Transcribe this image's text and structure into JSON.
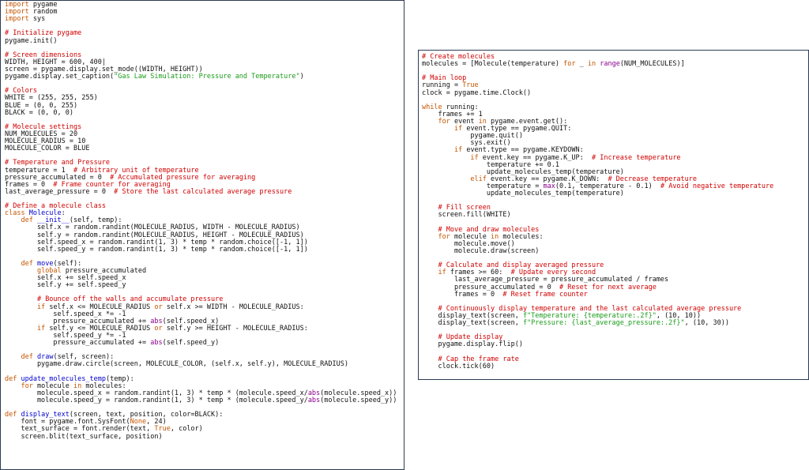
{
  "theme": {
    "keyword": "#c45500",
    "comment": "#d00000",
    "string": "#1a9b1a",
    "builtin": "#8b008b",
    "function": "#0000cc",
    "text": "#111111",
    "border": "#2d3b55"
  },
  "left_code": [
    [
      [
        "kw",
        "import"
      ],
      [
        "ln",
        " pygame"
      ]
    ],
    [
      [
        "kw",
        "import"
      ],
      [
        "ln",
        " random"
      ]
    ],
    [
      [
        "kw",
        "import"
      ],
      [
        "ln",
        " sys"
      ]
    ],
    [],
    [
      [
        "cm",
        "# Initialize pygame"
      ]
    ],
    [
      [
        "ln",
        "pygame.init()"
      ]
    ],
    [],
    [
      [
        "cm",
        "# Screen dimensions"
      ]
    ],
    [
      [
        "ln",
        "WIDTH, HEIGHT = 600, 400|"
      ]
    ],
    [
      [
        "ln",
        "screen = pygame.display.set_mode((WIDTH, HEIGHT))"
      ]
    ],
    [
      [
        "ln",
        "pygame.display.set_caption("
      ],
      [
        "st",
        "\"Gas Law Simulation: Pressure and Temperature\""
      ],
      [
        "ln",
        ")"
      ]
    ],
    [],
    [
      [
        "cm",
        "# Colors"
      ]
    ],
    [
      [
        "ln",
        "WHITE = (255, 255, 255)"
      ]
    ],
    [
      [
        "ln",
        "BLUE = (0, 0, 255)"
      ]
    ],
    [
      [
        "ln",
        "BLACK = (0, 0, 0)"
      ]
    ],
    [],
    [
      [
        "cm",
        "# Molecule settings"
      ]
    ],
    [
      [
        "ln",
        "NUM_MOLECULES = 20"
      ]
    ],
    [
      [
        "ln",
        "MOLECULE_RADIUS = 10"
      ]
    ],
    [
      [
        "ln",
        "MOLECULE_COLOR = BLUE"
      ]
    ],
    [],
    [
      [
        "cm",
        "# Temperature and Pressure"
      ]
    ],
    [
      [
        "ln",
        "temperature = 1  "
      ],
      [
        "cm",
        "# Arbitrary unit of temperature"
      ]
    ],
    [
      [
        "ln",
        "pressure_accumulated = 0  "
      ],
      [
        "cm",
        "# Accumulated pressure for averaging"
      ]
    ],
    [
      [
        "ln",
        "frames = 0  "
      ],
      [
        "cm",
        "# Frame counter for averaging"
      ]
    ],
    [
      [
        "ln",
        "last_average_pressure = 0  "
      ],
      [
        "cm",
        "# Store the last calculated average pressure"
      ]
    ],
    [],
    [
      [
        "cm",
        "# Define a molecule class"
      ]
    ],
    [
      [
        "kw",
        "class"
      ],
      [
        "ln",
        " "
      ],
      [
        "fn",
        "Molecule"
      ],
      [
        "ln",
        ":"
      ]
    ],
    [
      [
        "ln",
        "    "
      ],
      [
        "kw",
        "def"
      ],
      [
        "ln",
        " "
      ],
      [
        "fn",
        "__init__"
      ],
      [
        "ln",
        "(self, temp):"
      ]
    ],
    [
      [
        "ln",
        "        self.x = random.randint(MOLECULE_RADIUS, WIDTH - MOLECULE_RADIUS)"
      ]
    ],
    [
      [
        "ln",
        "        self.y = random.randint(MOLECULE_RADIUS, HEIGHT - MOLECULE_RADIUS)"
      ]
    ],
    [
      [
        "ln",
        "        self.speed_x = random.randint(1, 3) * temp * random.choice([-1, 1])"
      ]
    ],
    [
      [
        "ln",
        "        self.speed_y = random.randint(1, 3) * temp * random.choice([-1, 1])"
      ]
    ],
    [],
    [
      [
        "ln",
        "    "
      ],
      [
        "kw",
        "def"
      ],
      [
        "ln",
        " "
      ],
      [
        "fn",
        "move"
      ],
      [
        "ln",
        "(self):"
      ]
    ],
    [
      [
        "ln",
        "        "
      ],
      [
        "kw",
        "global"
      ],
      [
        "ln",
        " pressure_accumulated"
      ]
    ],
    [
      [
        "ln",
        "        self.x += self.speed_x"
      ]
    ],
    [
      [
        "ln",
        "        self.y += self.speed_y"
      ]
    ],
    [],
    [
      [
        "ln",
        "        "
      ],
      [
        "cm",
        "# Bounce off the walls and accumulate pressure"
      ]
    ],
    [
      [
        "ln",
        "        "
      ],
      [
        "kw",
        "if"
      ],
      [
        "ln",
        " self.x <= MOLECULE_RADIUS "
      ],
      [
        "kw",
        "or"
      ],
      [
        "ln",
        " self.x >= WIDTH - MOLECULE_RADIUS:"
      ]
    ],
    [
      [
        "ln",
        "            self.speed_x *= -1"
      ]
    ],
    [
      [
        "ln",
        "            pressure_accumulated += "
      ],
      [
        "bi",
        "abs"
      ],
      [
        "ln",
        "(self.speed_x)"
      ]
    ],
    [
      [
        "ln",
        "        "
      ],
      [
        "kw",
        "if"
      ],
      [
        "ln",
        " self.y <= MOLECULE_RADIUS "
      ],
      [
        "kw",
        "or"
      ],
      [
        "ln",
        " self.y >= HEIGHT - MOLECULE_RADIUS:"
      ]
    ],
    [
      [
        "ln",
        "            self.speed_y *= -1"
      ]
    ],
    [
      [
        "ln",
        "            pressure_accumulated += "
      ],
      [
        "bi",
        "abs"
      ],
      [
        "ln",
        "(self.speed_y)"
      ]
    ],
    [],
    [
      [
        "ln",
        "    "
      ],
      [
        "kw",
        "def"
      ],
      [
        "ln",
        " "
      ],
      [
        "fn",
        "draw"
      ],
      [
        "ln",
        "(self, screen):"
      ]
    ],
    [
      [
        "ln",
        "        pygame.draw.circle(screen, MOLECULE_COLOR, (self.x, self.y), MOLECULE_RADIUS)"
      ]
    ],
    [],
    [
      [
        "kw",
        "def"
      ],
      [
        "ln",
        " "
      ],
      [
        "fn",
        "update_molecules_temp"
      ],
      [
        "ln",
        "(temp):"
      ]
    ],
    [
      [
        "ln",
        "    "
      ],
      [
        "kw",
        "for"
      ],
      [
        "ln",
        " molecule "
      ],
      [
        "kw",
        "in"
      ],
      [
        "ln",
        " molecules:"
      ]
    ],
    [
      [
        "ln",
        "        molecule.speed_x = random.randint(1, 3) * temp * (molecule.speed_x/"
      ],
      [
        "bi",
        "abs"
      ],
      [
        "ln",
        "(molecule.speed_x))"
      ]
    ],
    [
      [
        "ln",
        "        molecule.speed_y = random.randint(1, 3) * temp * (molecule.speed_y/"
      ],
      [
        "bi",
        "abs"
      ],
      [
        "ln",
        "(molecule.speed_y))"
      ]
    ],
    [],
    [
      [
        "kw",
        "def"
      ],
      [
        "ln",
        " "
      ],
      [
        "fn",
        "display_text"
      ],
      [
        "ln",
        "(screen, text, position, color=BLACK):"
      ]
    ],
    [
      [
        "ln",
        "    font = pygame.font.SysFont("
      ],
      [
        "kw",
        "None"
      ],
      [
        "ln",
        ", 24)"
      ]
    ],
    [
      [
        "ln",
        "    text_surface = font.render(text, "
      ],
      [
        "kw",
        "True"
      ],
      [
        "ln",
        ", color)"
      ]
    ],
    [
      [
        "ln",
        "    screen.blit(text_surface, position)"
      ]
    ]
  ],
  "right_code": [
    [
      [
        "cm",
        "# Create molecules"
      ]
    ],
    [
      [
        "ln",
        "molecules = [Molecule(temperature) "
      ],
      [
        "kw",
        "for"
      ],
      [
        "ln",
        " _ "
      ],
      [
        "kw",
        "in"
      ],
      [
        "ln",
        " "
      ],
      [
        "bi",
        "range"
      ],
      [
        "ln",
        "(NUM_MOLECULES)]"
      ]
    ],
    [],
    [
      [
        "cm",
        "# Main loop"
      ]
    ],
    [
      [
        "ln",
        "running = "
      ],
      [
        "kw",
        "True"
      ]
    ],
    [
      [
        "ln",
        "clock = pygame.time.Clock()"
      ]
    ],
    [],
    [
      [
        "kw",
        "while"
      ],
      [
        "ln",
        " running:"
      ]
    ],
    [
      [
        "ln",
        "    frames += 1"
      ]
    ],
    [
      [
        "ln",
        "    "
      ],
      [
        "kw",
        "for"
      ],
      [
        "ln",
        " event "
      ],
      [
        "kw",
        "in"
      ],
      [
        "ln",
        " pygame.event.get():"
      ]
    ],
    [
      [
        "ln",
        "        "
      ],
      [
        "kw",
        "if"
      ],
      [
        "ln",
        " event.type == pygame.QUIT:"
      ]
    ],
    [
      [
        "ln",
        "            pygame.quit()"
      ]
    ],
    [
      [
        "ln",
        "            sys.exit()"
      ]
    ],
    [
      [
        "ln",
        "        "
      ],
      [
        "kw",
        "if"
      ],
      [
        "ln",
        " event.type == pygame.KEYDOWN:"
      ]
    ],
    [
      [
        "ln",
        "            "
      ],
      [
        "kw",
        "if"
      ],
      [
        "ln",
        " event.key == pygame.K_UP:  "
      ],
      [
        "cm",
        "# Increase temperature"
      ]
    ],
    [
      [
        "ln",
        "                temperature += 0.1"
      ]
    ],
    [
      [
        "ln",
        "                update_molecules_temp(temperature)"
      ]
    ],
    [
      [
        "ln",
        "            "
      ],
      [
        "kw",
        "elif"
      ],
      [
        "ln",
        " event.key == pygame.K_DOWN:  "
      ],
      [
        "cm",
        "# Decrease temperature"
      ]
    ],
    [
      [
        "ln",
        "                temperature = "
      ],
      [
        "bi",
        "max"
      ],
      [
        "ln",
        "(0.1, temperature - 0.1)  "
      ],
      [
        "cm",
        "# Avoid negative temperature"
      ]
    ],
    [
      [
        "ln",
        "                update_molecules_temp(temperature)"
      ]
    ],
    [],
    [
      [
        "ln",
        "    "
      ],
      [
        "cm",
        "# Fill screen"
      ]
    ],
    [
      [
        "ln",
        "    screen.fill(WHITE)"
      ]
    ],
    [],
    [
      [
        "ln",
        "    "
      ],
      [
        "cm",
        "# Move and draw molecules"
      ]
    ],
    [
      [
        "ln",
        "    "
      ],
      [
        "kw",
        "for"
      ],
      [
        "ln",
        " molecule "
      ],
      [
        "kw",
        "in"
      ],
      [
        "ln",
        " molecules:"
      ]
    ],
    [
      [
        "ln",
        "        molecule.move()"
      ]
    ],
    [
      [
        "ln",
        "        molecule.draw(screen)"
      ]
    ],
    [],
    [
      [
        "ln",
        "    "
      ],
      [
        "cm",
        "# Calculate and display averaged pressure"
      ]
    ],
    [
      [
        "ln",
        "    "
      ],
      [
        "kw",
        "if"
      ],
      [
        "ln",
        " frames >= 60:  "
      ],
      [
        "cm",
        "# Update every second"
      ]
    ],
    [
      [
        "ln",
        "        last_average_pressure = pressure_accumulated / frames"
      ]
    ],
    [
      [
        "ln",
        "        pressure_accumulated = 0  "
      ],
      [
        "cm",
        "# Reset for next average"
      ]
    ],
    [
      [
        "ln",
        "        frames = 0  "
      ],
      [
        "cm",
        "# Reset frame counter"
      ]
    ],
    [],
    [
      [
        "ln",
        "    "
      ],
      [
        "cm",
        "# Continuously display temperature and the last calculated average pressure"
      ]
    ],
    [
      [
        "ln",
        "    display_text(screen, "
      ],
      [
        "st",
        "f\"Temperature: {temperature:.2f}\""
      ],
      [
        "ln",
        ", (10, 10))"
      ]
    ],
    [
      [
        "ln",
        "    display_text(screen, "
      ],
      [
        "st",
        "f\"Pressure: {last_average_pressure:.2f}\""
      ],
      [
        "ln",
        ", (10, 30))"
      ]
    ],
    [],
    [
      [
        "ln",
        "    "
      ],
      [
        "cm",
        "# Update display"
      ]
    ],
    [
      [
        "ln",
        "    pygame.display.flip()"
      ]
    ],
    [],
    [
      [
        "ln",
        "    "
      ],
      [
        "cm",
        "# Cap the frame rate"
      ]
    ],
    [
      [
        "ln",
        "    clock.tick(60)"
      ]
    ]
  ]
}
